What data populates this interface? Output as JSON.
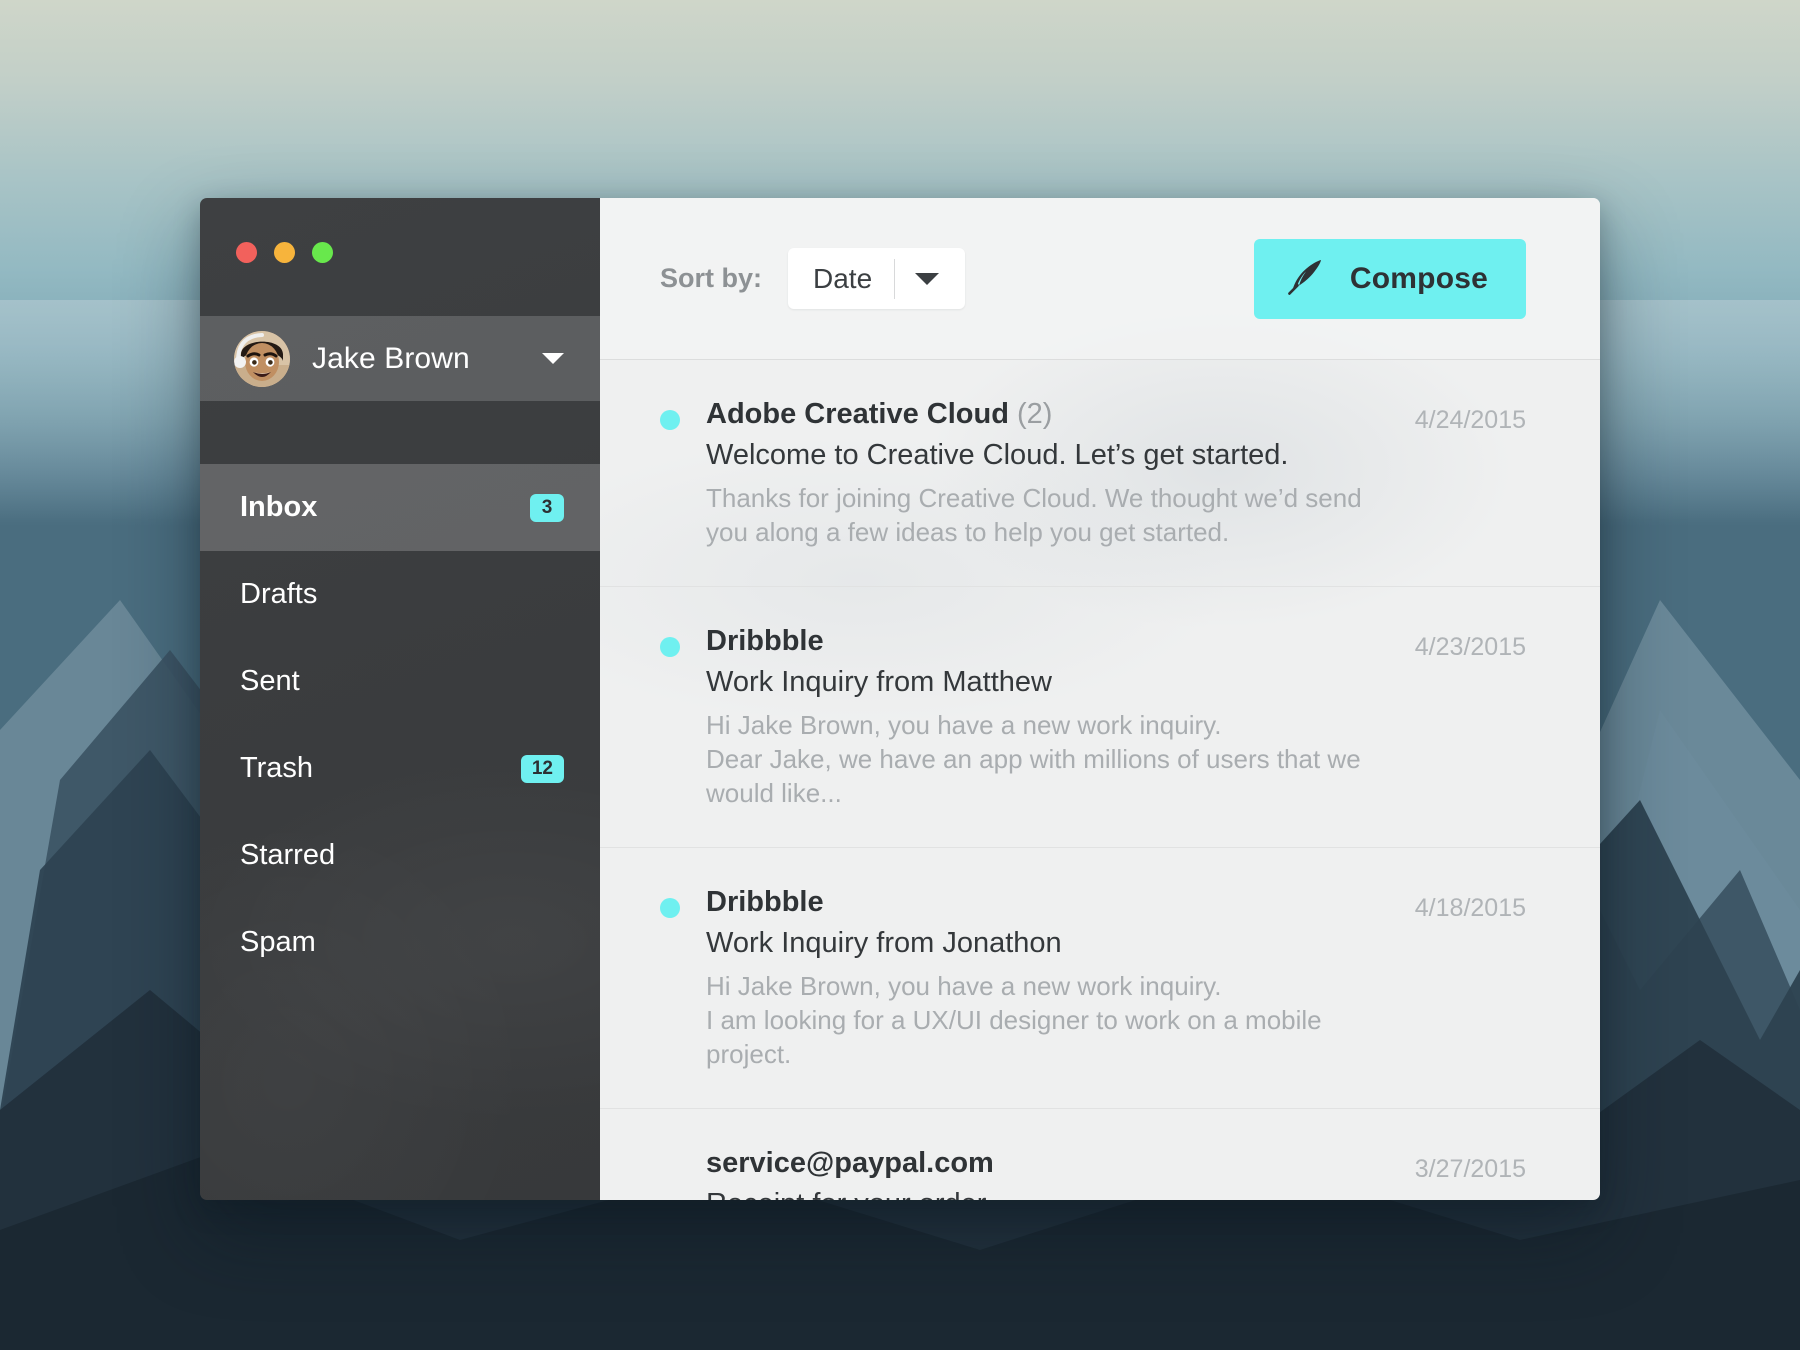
{
  "window": {
    "traffic_lights": [
      {
        "name": "close",
        "color": "#f2615c"
      },
      {
        "name": "minimize",
        "color": "#f7b43c"
      },
      {
        "name": "zoom",
        "color": "#68e84c"
      }
    ]
  },
  "accent_color": "#6ff0f0",
  "sidebar": {
    "user": {
      "name": "Jake Brown",
      "avatar_alt": "Jake Brown avatar"
    },
    "items": [
      {
        "label": "Inbox",
        "badge": "3",
        "active": true
      },
      {
        "label": "Drafts",
        "badge": "",
        "active": false
      },
      {
        "label": "Sent",
        "badge": "",
        "active": false
      },
      {
        "label": "Trash",
        "badge": "12",
        "active": false
      },
      {
        "label": "Starred",
        "badge": "",
        "active": false
      },
      {
        "label": "Spam",
        "badge": "",
        "active": false
      }
    ]
  },
  "toolbar": {
    "sort_label": "Sort by:",
    "sort_value": "Date",
    "sort_options": [
      "Date"
    ],
    "compose_label": "Compose",
    "compose_icon": "feather-icon"
  },
  "emails": [
    {
      "sender": "Adobe Creative Cloud",
      "count": "(2)",
      "subject": "Welcome to Creative Cloud. Let’s get started.",
      "preview": "Thanks for joining Creative Cloud. We thought we’d send you along a few ideas to help you get started.",
      "date": "4/24/2015",
      "unread": true
    },
    {
      "sender": "Dribbble",
      "count": "",
      "subject": "Work Inquiry from Matthew",
      "preview": "Hi Jake Brown, you have a new work inquiry.\nDear Jake, we have an app with millions of users that we would like...",
      "date": "4/23/2015",
      "unread": true
    },
    {
      "sender": "Dribbble",
      "count": "",
      "subject": "Work Inquiry from Jonathon",
      "preview": "Hi Jake Brown, you have a new work inquiry.\nI am looking for a UX/UI designer to work on a mobile project.",
      "date": "4/18/2015",
      "unread": true
    },
    {
      "sender": "service@paypal.com",
      "count": "",
      "subject": "Receipt for your order",
      "preview": "",
      "date": "3/27/2015",
      "unread": false
    }
  ]
}
